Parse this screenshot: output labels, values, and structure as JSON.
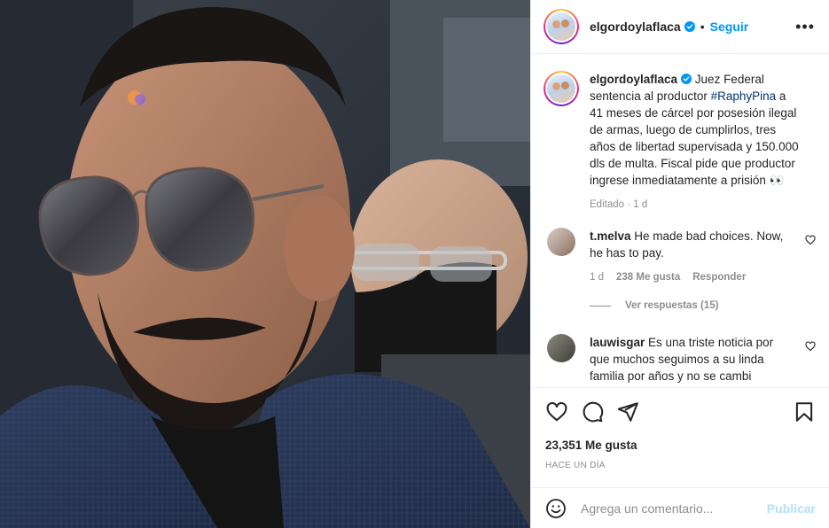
{
  "post": {
    "author": "elgordoylaflaca",
    "follow_label": "Seguir",
    "dot": "•",
    "more_label": "•••",
    "caption_body": " Juez Federal sentencia al productor ",
    "hashtag": "#RaphyPina",
    "caption_tail": " a 41 meses de cárcel por posesión ilegal de armas, luego de cumplirlos, tres años de libertad supervisada y 150.000 dls de multa. Fiscal pide que productor ingrese inmediatamente a prisión 👀",
    "caption_meta": "Editado · 1 d",
    "likes_text": "23,351 Me gusta",
    "time_ago": "HACE UN DÍA"
  },
  "comments": [
    {
      "user": "t.melva",
      "text": " He made bad choices. Now, he has to pay.",
      "age": "1 d",
      "likes": "238 Me gusta",
      "reply_label": "Responder",
      "replies_label": "Ver respuestas (15)"
    },
    {
      "user": "lauwisgar",
      "text": " Es una triste noticia por que muchos seguimos a su linda familia por años y no se cambi"
    }
  ],
  "composer": {
    "placeholder": "Agrega un comentario...",
    "post_label": "Publicar"
  },
  "icons": {
    "verified": "verified-badge-icon",
    "like": "heart-icon",
    "comment": "comment-bubble-icon",
    "share": "paper-plane-icon",
    "save": "bookmark-icon",
    "emoji": "emoji-icon",
    "more": "more-options-icon"
  },
  "colors": {
    "accent": "#0095f6",
    "post_disabled": "#b2dffc",
    "muted": "#8e8e8e",
    "hashtag": "#00376b"
  }
}
